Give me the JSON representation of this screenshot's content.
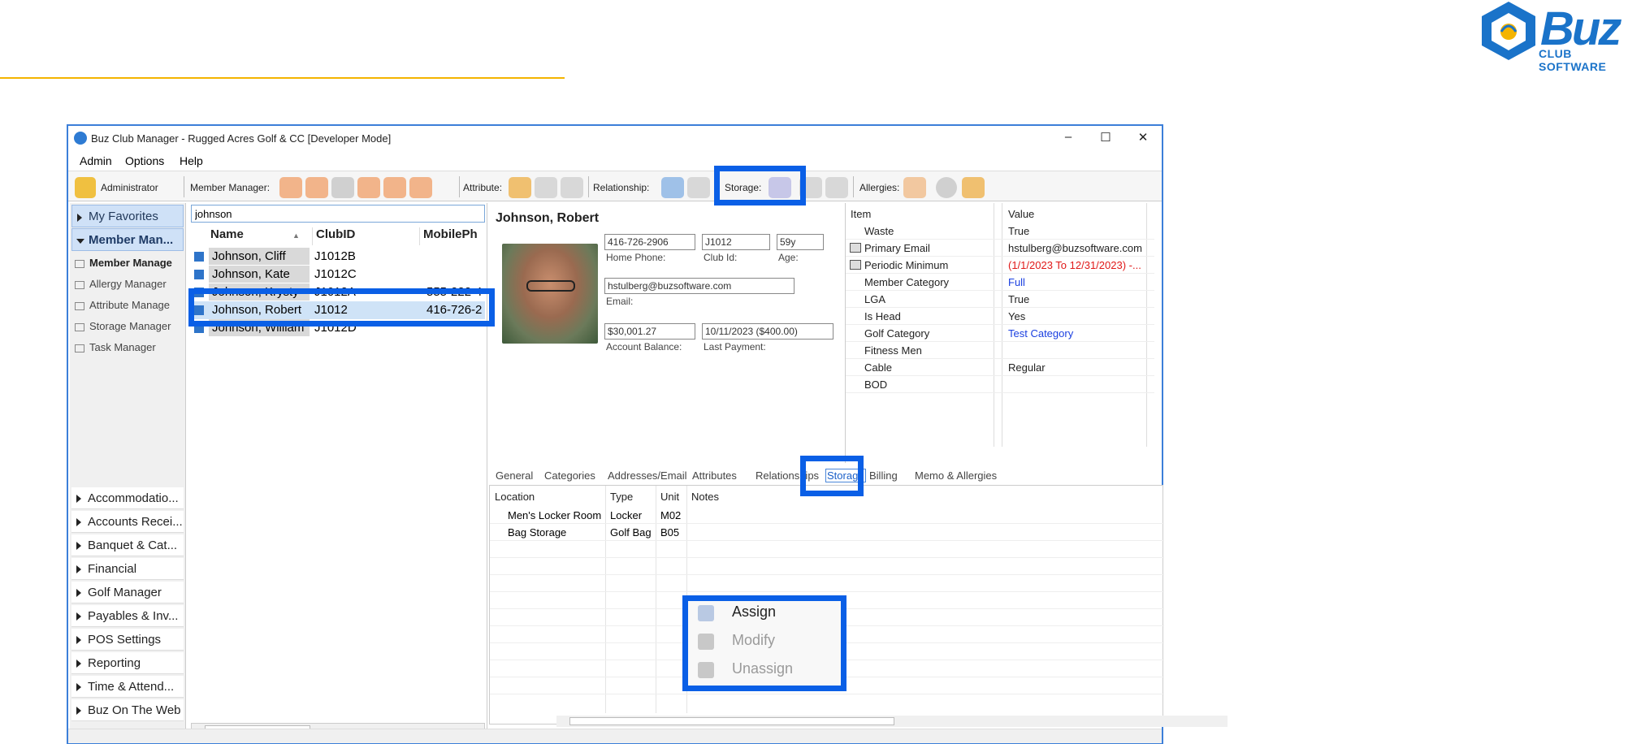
{
  "logo": {
    "word": "Buz",
    "sub": "CLUB SOFTWARE"
  },
  "window": {
    "title": "Buz Club Manager - Rugged Acres Golf & CC [Developer Mode]",
    "minimize": "–",
    "maximize": "☐",
    "close": "✕"
  },
  "menu": {
    "admin": "Admin",
    "options": "Options",
    "help": "Help"
  },
  "toolbar": {
    "user": "Administrator",
    "member_manager": "Member Manager:",
    "attribute": "Attribute:",
    "relationship": "Relationship:",
    "storage": "Storage:",
    "allergies": "Allergies:"
  },
  "nav": {
    "favorites": "My Favorites",
    "member_manager": "Member Man...",
    "sub": [
      "Member Manage",
      "Allergy Manager",
      "Attribute Manage",
      "Storage Manager",
      "Task Manager"
    ],
    "groups": [
      "Accommodatio...",
      "Accounts Recei...",
      "Banquet & Cat...",
      "Financial",
      "Golf Manager",
      "Payables & Inv...",
      "POS Settings",
      "Reporting",
      "Time & Attend...",
      "Buz On The Web"
    ]
  },
  "member_list": {
    "search": "johnson",
    "headers": {
      "name": "Name",
      "club_id": "ClubID",
      "mobile": "MobilePh"
    },
    "rows": [
      {
        "name": "Johnson, Cliff",
        "club_id": "J1012B",
        "mobile": ""
      },
      {
        "name": "Johnson, Kate",
        "club_id": "J1012C",
        "mobile": ""
      },
      {
        "name": "Johnson, Krysty",
        "club_id": "J1012A",
        "mobile": "555-222-4"
      },
      {
        "name": "Johnson, Robert",
        "club_id": "J1012",
        "mobile": "416-726-2"
      },
      {
        "name": "Johnson, William",
        "club_id": "J1012D",
        "mobile": ""
      }
    ]
  },
  "detail": {
    "name": "Johnson, Robert",
    "home_phone": "416-726-2906",
    "home_phone_label": "Home Phone:",
    "club_id": "J1012",
    "club_id_label": "Club Id:",
    "age": "59y",
    "age_label": "Age:",
    "email": "hstulberg@buzsoftware.com",
    "email_label": "Email:",
    "balance": "$30,001.27",
    "balance_label": "Account Balance:",
    "last_payment": "10/11/2023 ($400.00)",
    "last_payment_label": "Last Payment:"
  },
  "properties": {
    "headers": {
      "item": "Item",
      "value": "Value"
    },
    "rows": [
      {
        "item": "Waste",
        "value": "True"
      },
      {
        "item": "Primary Email",
        "value": "hstulberg@buzsoftware.com"
      },
      {
        "item": "Periodic Minimum",
        "value": "(1/1/2023 To 12/31/2023) -..."
      },
      {
        "item": "Member Category",
        "value": "Full"
      },
      {
        "item": "LGA",
        "value": "True"
      },
      {
        "item": "Is Head",
        "value": "Yes"
      },
      {
        "item": "Golf Category",
        "value": "Test Category"
      },
      {
        "item": "Fitness Men",
        "value": ""
      },
      {
        "item": "Cable",
        "value": "Regular"
      },
      {
        "item": "BOD",
        "value": ""
      }
    ],
    "colors": {
      "link": "#1a3fe0",
      "alert": "#e01818"
    }
  },
  "tabs": [
    "General",
    "Categories",
    "Addresses/Email",
    "Attributes",
    "Relationships",
    "Storage",
    "Billing",
    "Memo & Allergies"
  ],
  "storage_table": {
    "headers": {
      "location": "Location",
      "type": "Type",
      "unit": "Unit",
      "notes": "Notes"
    },
    "rows": [
      {
        "location": "Men's Locker Room",
        "type": "Locker",
        "unit": "M02",
        "notes": ""
      },
      {
        "location": "Bag Storage",
        "type": "Golf Bag",
        "unit": "B05",
        "notes": ""
      }
    ]
  },
  "context_menu": {
    "assign": "Assign",
    "modify": "Modify",
    "unassign": "Unassign"
  },
  "colors": {
    "accent": "#0a5fe6",
    "orange_rule": "#f4b400",
    "brand": "#1a73c9"
  }
}
